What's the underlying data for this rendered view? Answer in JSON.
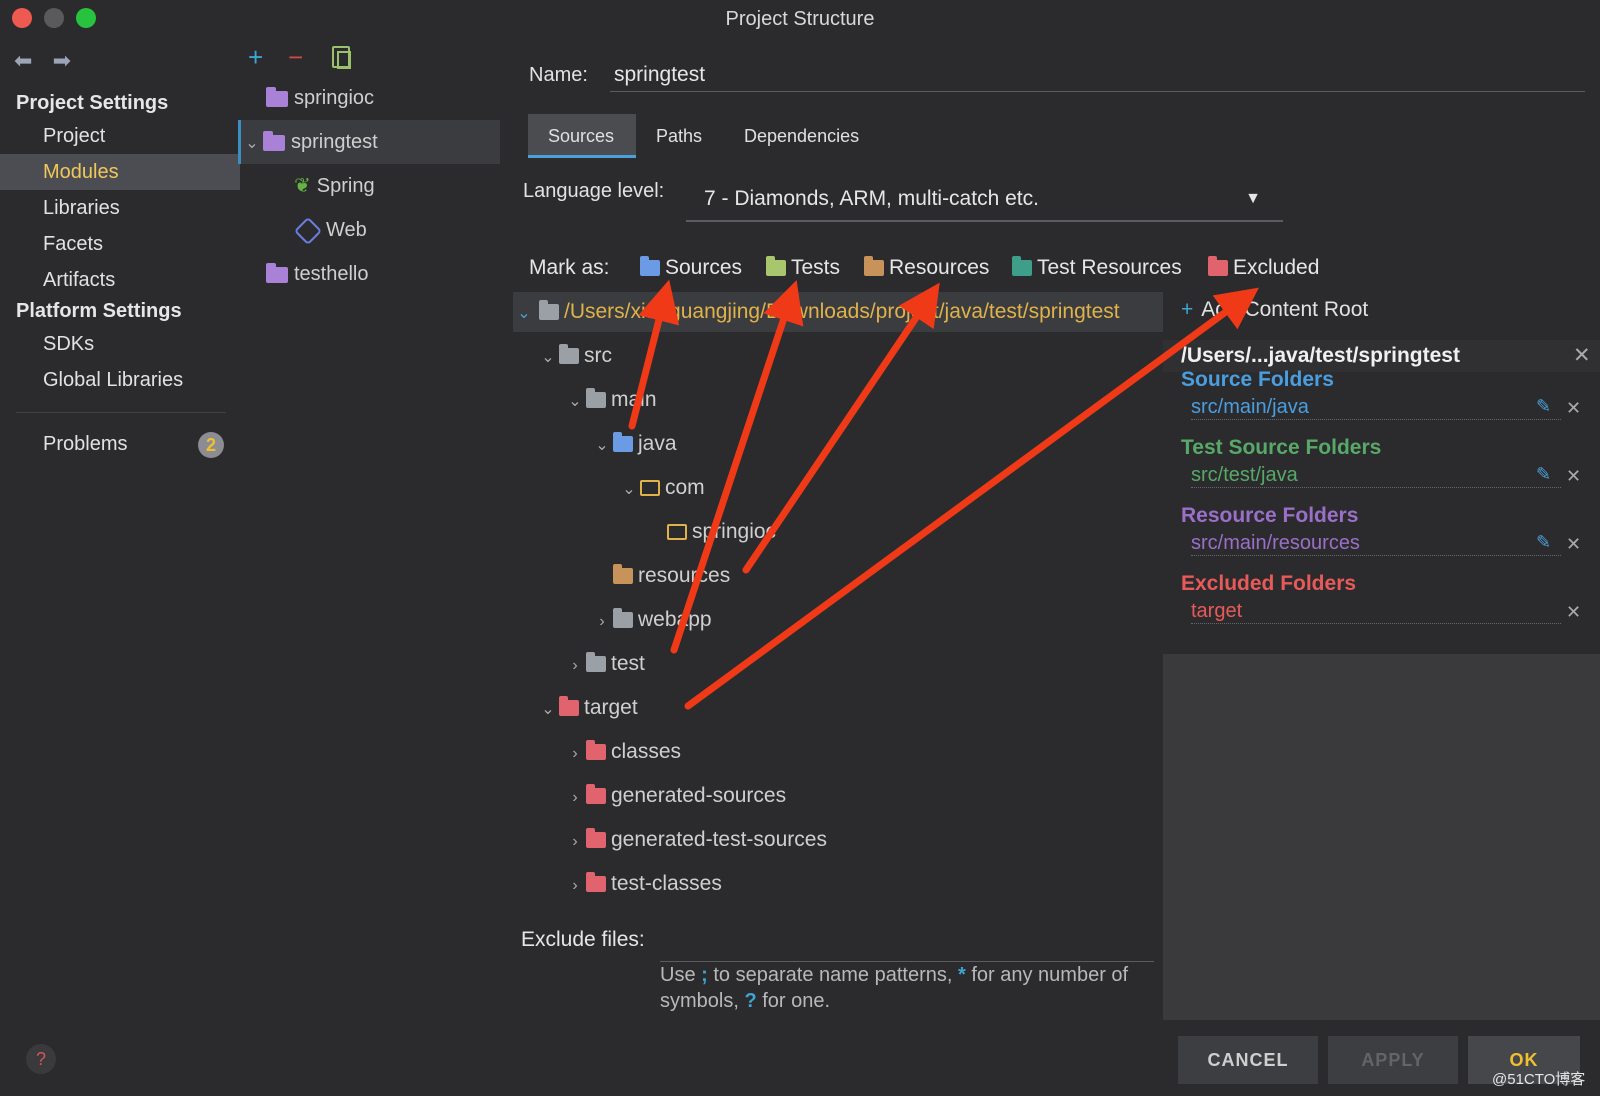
{
  "window": {
    "title": "Project Structure"
  },
  "left": {
    "project_settings": "Project Settings",
    "items_project": [
      "Project",
      "Modules",
      "Libraries",
      "Facets",
      "Artifacts"
    ],
    "platform_settings": "Platform Settings",
    "items_platform": [
      "SDKs",
      "Global Libraries"
    ],
    "problems": "Problems",
    "problems_count": "2",
    "selected": "Modules"
  },
  "modules": {
    "items": [
      "springioc",
      "springtest",
      "Spring",
      "Web",
      "testhello"
    ]
  },
  "main": {
    "name_label": "Name:",
    "name_value": "springtest",
    "tabs": [
      "Sources",
      "Paths",
      "Dependencies"
    ],
    "lang_label": "Language level:",
    "lang_value": "7 - Diamonds, ARM, multi-catch etc.",
    "mark_as": "Mark as:",
    "mark_buttons": [
      "Sources",
      "Tests",
      "Resources",
      "Test Resources",
      "Excluded"
    ],
    "tree": {
      "root": "/Users/xiaoguangjing/Downloads/project/java/test/springtest",
      "rows": [
        "src",
        "main",
        "java",
        "com",
        "springioc",
        "resources",
        "webapp",
        "test",
        "target",
        "classes",
        "generated-sources",
        "generated-test-sources",
        "test-classes"
      ]
    },
    "exclude_label": "Exclude files:",
    "exclude_help_1": "Use",
    "exclude_help_semi": ";",
    "exclude_help_2": "to separate name patterns,",
    "exclude_help_star": "*",
    "exclude_help_3": "for any number of symbols,",
    "exclude_help_q": "?",
    "exclude_help_4": "for one."
  },
  "content_root": {
    "add": "Add Content Root",
    "header": "/Users/...java/test/springtest",
    "source_title": "Source Folders",
    "source_path": "src/main/java",
    "test_title": "Test Source Folders",
    "test_path": "src/test/java",
    "res_title": "Resource Folders",
    "res_path": "src/main/resources",
    "excl_title": "Excluded Folders",
    "excl_path": "target",
    "colors": {
      "source": "#4a9ee0",
      "test": "#58a868",
      "resource": "#9a6fc8",
      "excluded": "#e85a5a"
    }
  },
  "buttons": {
    "cancel": "CANCEL",
    "apply": "APPLY",
    "ok": "OK"
  },
  "watermark": "@51CTO博客"
}
